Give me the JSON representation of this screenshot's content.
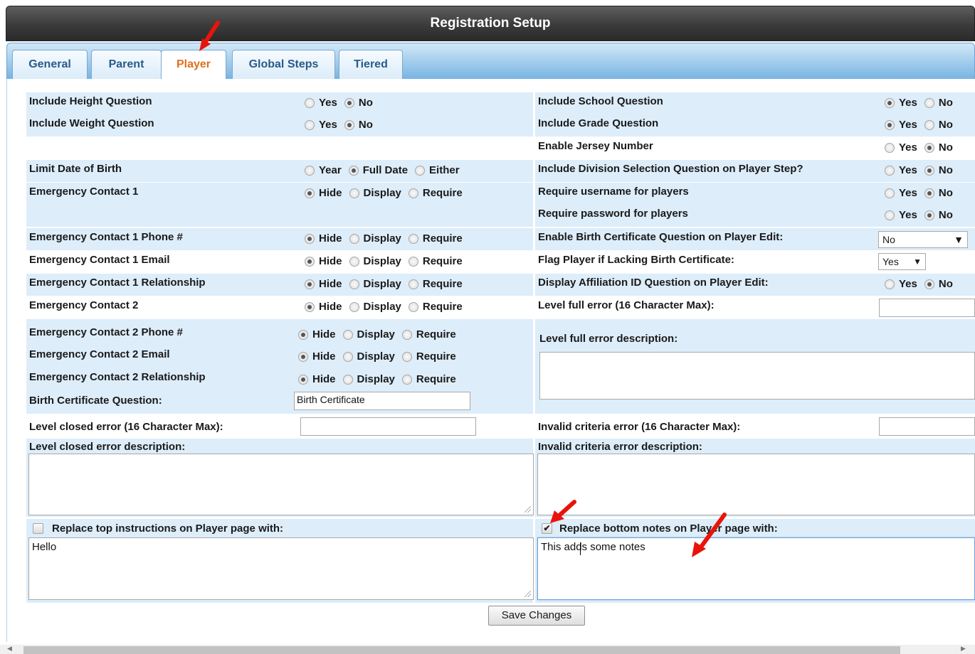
{
  "window": {
    "title": "Registration Setup"
  },
  "tabs": [
    {
      "label": "General"
    },
    {
      "label": "Parent"
    },
    {
      "label": "Player"
    },
    {
      "label": "Global Steps"
    },
    {
      "label": "Tiered"
    }
  ],
  "active_tab": "Player",
  "options": {
    "yes": "Yes",
    "no": "No",
    "year": "Year",
    "full_date": "Full Date",
    "either": "Either",
    "hide": "Hide",
    "display": "Display",
    "require": "Require"
  },
  "left": {
    "height_q": "Include Height Question",
    "weight_q": "Include Weight Question",
    "dob": "Limit Date of Birth",
    "ec1": "Emergency Contact 1",
    "ec1_phone": "Emergency Contact 1 Phone #",
    "ec1_email": "Emergency Contact 1 Email",
    "ec1_rel": "Emergency Contact 1 Relationship",
    "ec2": "Emergency Contact 2",
    "ec2_phone": "Emergency Contact 2 Phone #",
    "ec2_email": "Emergency Contact 2 Email",
    "ec2_rel": "Emergency Contact 2 Relationship",
    "bc_q": "Birth Certificate Question:",
    "bc_q_value": "Birth Certificate",
    "closed_err": "Level closed error (16 Character Max):",
    "closed_err_value": "",
    "closed_desc": "Level closed error description:",
    "closed_desc_value": "",
    "top_instr": "Replace top instructions on Player page with:",
    "top_instr_checked": false,
    "top_instr_value": "Hello"
  },
  "right": {
    "school_q": "Include School Question",
    "grade_q": "Include Grade Question",
    "jersey": "Enable Jersey Number",
    "division_q": "Include Division Selection Question on Player Step?",
    "req_username": "Require username for players",
    "req_password": "Require password for players",
    "bc_edit": "Enable Birth Certificate Question on Player Edit:",
    "bc_edit_value": "No",
    "flag_bc": "Flag Player if Lacking Birth Certificate:",
    "flag_bc_value": "Yes",
    "affil": "Display Affiliation ID Question on Player Edit:",
    "full_err": "Level full error (16 Character Max):",
    "full_err_value": "",
    "full_desc": "Level full error description:",
    "full_desc_value": "",
    "invalid_err": "Invalid criteria error (16 Character Max):",
    "invalid_err_value": "",
    "invalid_desc": "Invalid criteria error description:",
    "invalid_desc_value": "",
    "bottom_notes": "Replace bottom notes on Player page with:",
    "bottom_notes_checked": true,
    "bottom_notes_value": "This adds some notes"
  },
  "save_button": "Save Changes",
  "colors": {
    "active_tab": "#e0701e",
    "tab_text": "#2a5a8a",
    "row_shade": "#ddedfa",
    "annotation_arrow": "#e8140c"
  }
}
